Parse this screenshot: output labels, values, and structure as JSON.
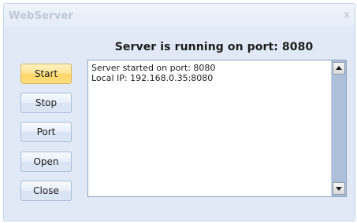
{
  "window": {
    "title": "WebServer",
    "close_glyph": "x"
  },
  "status": {
    "heading": "Server is running on port: 8080"
  },
  "buttons": {
    "start": "Start",
    "stop": "Stop",
    "port": "Port",
    "open": "Open",
    "close": "Close"
  },
  "log": {
    "lines": [
      "Server started on port: 8080",
      "Local IP: 192.168.0.35:8080"
    ]
  },
  "colors": {
    "window_bg": "#e0e9f5",
    "active_button": "#ffd666",
    "scrollbar_track": "#aec0d9"
  },
  "icons": {
    "scroll_up": "up-arrow-icon",
    "scroll_down": "down-arrow-icon",
    "close": "close-icon"
  }
}
